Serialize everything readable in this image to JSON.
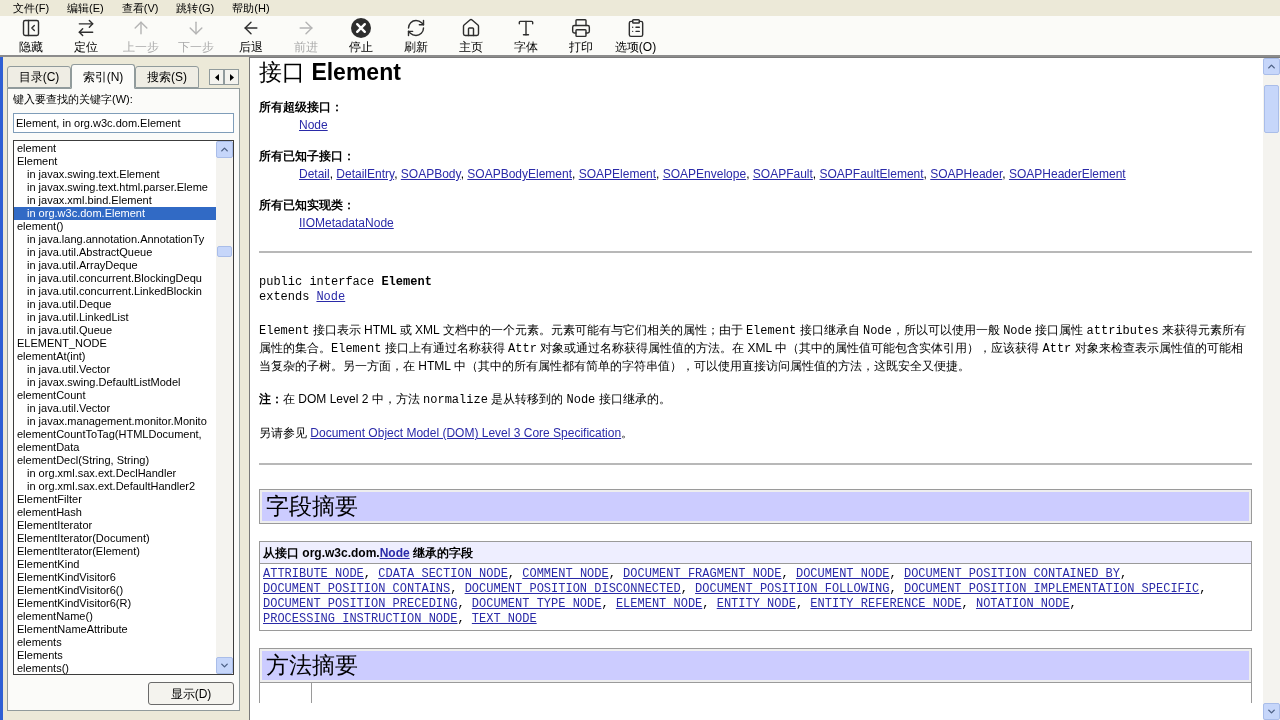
{
  "menu_bar": [
    "文件(F)",
    "编辑(E)",
    "查看(V)",
    "跳转(G)",
    "帮助(H)"
  ],
  "toolbar": [
    {
      "label": "隐藏",
      "disabled": false
    },
    {
      "label": "定位",
      "disabled": false
    },
    {
      "label": "上一步",
      "disabled": true
    },
    {
      "label": "下一步",
      "disabled": true
    },
    {
      "label": "后退",
      "disabled": false
    },
    {
      "label": "前进",
      "disabled": true
    },
    {
      "label": "停止",
      "disabled": false
    },
    {
      "label": "刷新",
      "disabled": false
    },
    {
      "label": "主页",
      "disabled": false
    },
    {
      "label": "字体",
      "disabled": false
    },
    {
      "label": "打印",
      "disabled": false
    },
    {
      "label": "选项(O)",
      "disabled": false
    }
  ],
  "sidebar": {
    "tabs": [
      {
        "label": "目录(C)",
        "selected": false
      },
      {
        "label": "索引(N)",
        "selected": true
      },
      {
        "label": "搜索(S)",
        "selected": false
      }
    ],
    "keyword_label": "键入要查找的关键字(W):",
    "keyword_field": {
      "value": "Element, in org.w3c.dom.Element"
    },
    "index_items": [
      {
        "label": "element",
        "selected": false
      },
      {
        "label": "Element",
        "selected": false,
        "children": [
          {
            "label": "in javax.swing.text.Element",
            "selected": false
          },
          {
            "label": "in javax.swing.text.html.parser.Eleme",
            "selected": false
          },
          {
            "label": "in javax.xml.bind.Element",
            "selected": false
          },
          {
            "label": "in org.w3c.dom.Element",
            "selected": true
          }
        ]
      },
      {
        "label": "element()",
        "selected": false,
        "children": [
          {
            "label": "in java.lang.annotation.AnnotationTy",
            "selected": false
          },
          {
            "label": "in java.util.AbstractQueue",
            "selected": false
          },
          {
            "label": "in java.util.ArrayDeque",
            "selected": false
          },
          {
            "label": "in java.util.concurrent.BlockingDequ",
            "selected": false
          },
          {
            "label": "in java.util.concurrent.LinkedBlockin",
            "selected": false
          },
          {
            "label": "in java.util.Deque",
            "selected": false
          },
          {
            "label": "in java.util.LinkedList",
            "selected": false
          },
          {
            "label": "in java.util.Queue",
            "selected": false
          }
        ]
      },
      {
        "label": "ELEMENT_NODE",
        "selected": false
      },
      {
        "label": "elementAt(int)",
        "selected": false,
        "children": [
          {
            "label": "in java.util.Vector",
            "selected": false
          },
          {
            "label": "in javax.swing.DefaultListModel",
            "selected": false
          }
        ]
      },
      {
        "label": "elementCount",
        "selected": false,
        "children": [
          {
            "label": "in java.util.Vector",
            "selected": false
          },
          {
            "label": "in javax.management.monitor.Monito",
            "selected": false
          }
        ]
      },
      {
        "label": "elementCountToTag(HTMLDocument,",
        "selected": false
      },
      {
        "label": "elementData",
        "selected": false
      },
      {
        "label": "elementDecl(String, String)",
        "selected": false,
        "children": [
          {
            "label": "in org.xml.sax.ext.DeclHandler",
            "selected": false
          },
          {
            "label": "in org.xml.sax.ext.DefaultHandler2",
            "selected": false
          }
        ]
      },
      {
        "label": "ElementFilter",
        "selected": false
      },
      {
        "label": "elementHash",
        "selected": false
      },
      {
        "label": "ElementIterator",
        "selected": false
      },
      {
        "label": "ElementIterator(Document)",
        "selected": false
      },
      {
        "label": "ElementIterator(Element)",
        "selected": false
      },
      {
        "label": "ElementKind",
        "selected": false
      },
      {
        "label": "ElementKindVisitor6",
        "selected": false
      },
      {
        "label": "ElementKindVisitor6()",
        "selected": false
      },
      {
        "label": "ElementKindVisitor6(R)",
        "selected": false
      },
      {
        "label": "elementName()",
        "selected": false
      },
      {
        "label": "ElementNameAttribute",
        "selected": false
      },
      {
        "label": "elements",
        "selected": false
      },
      {
        "label": "Elements",
        "selected": false
      },
      {
        "label": "elements()",
        "selected": false
      }
    ],
    "display_button": "显示(D)"
  },
  "content": {
    "heading": "接口 **Element**",
    "link_separator": ", ",
    "relations": [
      {
        "label": "所有超级接口：",
        "links": [
          "Node"
        ]
      },
      {
        "label": "所有已知子接口：",
        "links": [
          "Detail",
          "DetailEntry",
          "SOAPBody",
          "SOAPBodyElement",
          "SOAPElement",
          "SOAPEnvelope",
          "SOAPFault",
          "SOAPFaultElement",
          "SOAPHeader",
          "SOAPHeaderElement"
        ]
      },
      {
        "label": "所有已知实现类：",
        "links": [
          "IIOMetadataNode"
        ]
      }
    ],
    "declaration": {
      "signature": "public interface **Element**",
      "extends_keyword": "extends",
      "extends_link": "Node"
    },
    "paragraphs": [
      [
        {
          "kind": "code",
          "text": "Element"
        },
        {
          "kind": "text",
          "text": " 接口表示 HTML 或 XML 文档中的一个元素。元素可能有与它们相关的属性；由于 "
        },
        {
          "kind": "code",
          "text": "Element"
        },
        {
          "kind": "text",
          "text": " 接口继承自 "
        },
        {
          "kind": "code",
          "text": "Node"
        },
        {
          "kind": "text",
          "text": "，所以可以使用一般 "
        },
        {
          "kind": "code",
          "text": "Node"
        },
        {
          "kind": "text",
          "text": " 接口属性 "
        },
        {
          "kind": "code",
          "text": "attributes"
        },
        {
          "kind": "text",
          "text": " 来获得元素所有属性的集合。"
        },
        {
          "kind": "code",
          "text": "Element"
        },
        {
          "kind": "text",
          "text": " 接口上有通过名称获得 "
        },
        {
          "kind": "code",
          "text": "Attr"
        },
        {
          "kind": "text",
          "text": " 对象或通过名称获得属性值的方法。在 XML 中（其中的属性值可能包含实体引用），应该获得 "
        },
        {
          "kind": "code",
          "text": "Attr"
        },
        {
          "kind": "text",
          "text": " 对象来检查表示属性值的可能相当复杂的子树。另一方面，在 HTML 中（其中的所有属性都有简单的字符串值），可以使用直接访问属性值的方法，这既安全又便捷。"
        }
      ],
      [
        {
          "kind": "bold",
          "text": "注："
        },
        {
          "kind": "text",
          "text": "在 DOM Level 2 中，方法 "
        },
        {
          "kind": "code",
          "text": "normalize"
        },
        {
          "kind": "text",
          "text": " 是从转移到的 "
        },
        {
          "kind": "code",
          "text": "Node"
        },
        {
          "kind": "text",
          "text": " 接口继承的。"
        }
      ],
      [
        {
          "kind": "text",
          "text": "另请参见 "
        },
        {
          "kind": "link",
          "text": "Document Object Model (DOM) Level 3 Core Specification"
        },
        {
          "kind": "text",
          "text": "。"
        }
      ]
    ],
    "field_summary": {
      "title": "字段摘要",
      "inherited_header": [
        {
          "kind": "text",
          "text": "从接口 org.w3c.dom."
        },
        {
          "kind": "link",
          "text": "Node"
        },
        {
          "kind": "text",
          "text": " 继承的字段"
        }
      ],
      "fields": [
        "ATTRIBUTE_NODE",
        "CDATA_SECTION_NODE",
        "COMMENT_NODE",
        "DOCUMENT_FRAGMENT_NODE",
        "DOCUMENT_NODE",
        "DOCUMENT_POSITION_CONTAINED_BY",
        "DOCUMENT_POSITION_CONTAINS",
        "DOCUMENT_POSITION_DISCONNECTED",
        "DOCUMENT_POSITION_FOLLOWING",
        "DOCUMENT_POSITION_IMPLEMENTATION_SPECIFIC",
        "DOCUMENT_POSITION_PRECEDING",
        "DOCUMENT_TYPE_NODE",
        "ELEMENT_NODE",
        "ENTITY_NODE",
        "ENTITY_REFERENCE_NODE",
        "NOTATION_NODE",
        "PROCESSING_INSTRUCTION_NODE",
        "TEXT_NODE"
      ]
    },
    "method_summary": {
      "title": "方法摘要"
    }
  }
}
